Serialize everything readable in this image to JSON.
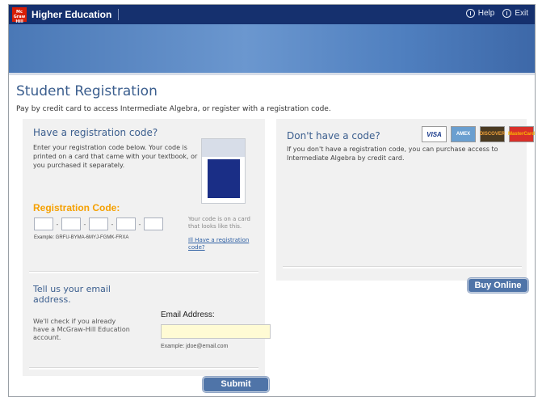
{
  "header": {
    "brand_name": "Higher Education",
    "help_label": "Help",
    "exit_label": "Exit"
  },
  "page": {
    "title": "Student Registration",
    "intro": "Pay by credit card to access Intermediate Algebra, or register with a registration code."
  },
  "have_code": {
    "heading": "Have a registration code?",
    "description": "Enter your registration code below. Your code is printed on a card that came with your textbook, or you purchased it separately.",
    "code_label": "Registration Code:",
    "example": "Example: GRFU-BYMA-6MYJ-FGMK-FRXA",
    "thumbnail_caption": "Your code is on a card that looks like this.",
    "illegal_code_link": "Ill Have a registration code?"
  },
  "email": {
    "heading": "Tell us your email address.",
    "description": "We'll check if you already have a McGraw-Hill Education account.",
    "label": "Email Address:",
    "value": "",
    "example": "Example: jdoe@email.com"
  },
  "submit_label": "Submit",
  "dont_have": {
    "heading": "Don't have a code?",
    "description": "If you don't have a registration code, you can purchase access to Intermediate Algebra by credit card.",
    "cards": [
      "VISA",
      "AMEX",
      "DISCOVER",
      "MasterCard"
    ],
    "buy_label": "Buy Online"
  },
  "colors": {
    "topbar": "#15306e",
    "accent_orange": "#f5a000",
    "title_blue": "#3b5e8e",
    "button_blue": "#4f74a8"
  }
}
